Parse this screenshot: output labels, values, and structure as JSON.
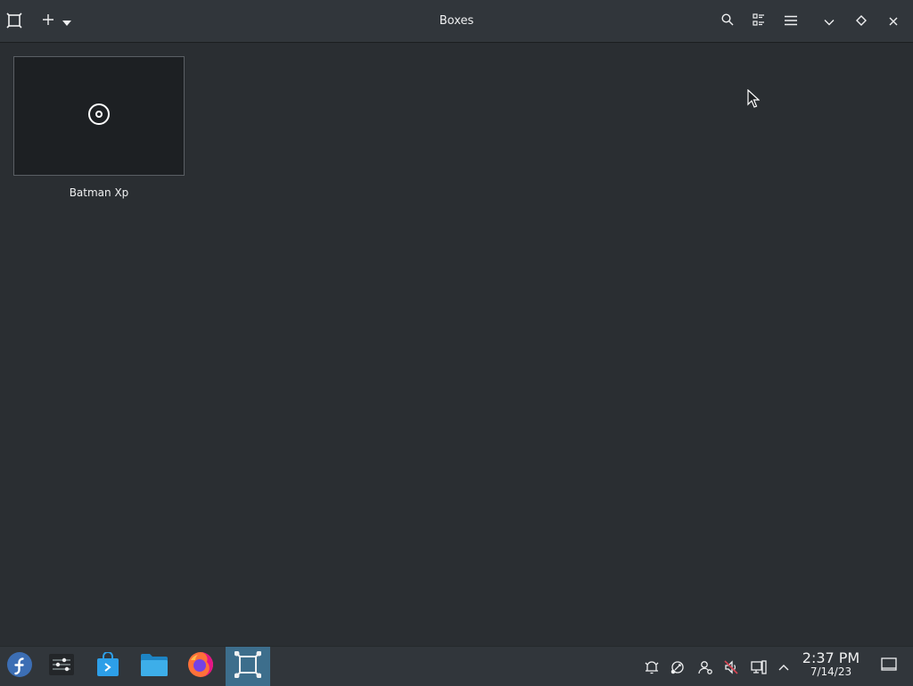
{
  "window": {
    "title": "Boxes"
  },
  "headerbar": {
    "left_buttons": [
      "boxes-logo-icon",
      "plus-icon",
      "dropdown-arrow-icon"
    ],
    "right_buttons": [
      "search-icon",
      "view-toggle-icon",
      "hamburger-menu-icon",
      "minimize-icon",
      "maximize-icon",
      "close-icon"
    ]
  },
  "machines": [
    {
      "name": "Batman Xp",
      "icon": "disc-icon"
    }
  ],
  "taskbar": {
    "launchers": [
      "fedora-logo-icon",
      "system-settings-icon",
      "discover-store-icon",
      "file-manager-icon",
      "firefox-icon",
      "boxes-icon"
    ],
    "active_launcher": "boxes-icon",
    "tray_icons": [
      "notifications-icon",
      "kde-connect-icon",
      "user-icon",
      "audio-muted-icon",
      "network-icon",
      "expand-tray-icon"
    ],
    "clock": {
      "time": "2:37 PM",
      "date": "7/14/23"
    }
  },
  "colors": {
    "background": "#2a2e32",
    "headerbar": "#31363b",
    "accent": "#3d6e8c",
    "text": "#eff0f1"
  }
}
